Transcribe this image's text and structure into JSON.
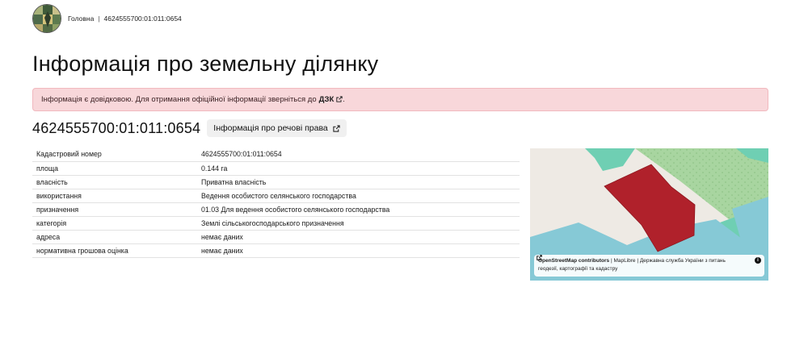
{
  "breadcrumb": {
    "home": "Головна",
    "separator": "|",
    "current": "4624555700:01:011:0654"
  },
  "page": {
    "title": "Інформація про земельну ділянку"
  },
  "alert": {
    "text": "Інформація є довідковою. Для отримання офіційної інформації зверніться до",
    "link": "ДЗК",
    "end": "."
  },
  "parcel": {
    "number": "4624555700:01:011:0654",
    "rights_button": "Інформація про речові права"
  },
  "rows": [
    {
      "key": "Кадастровий номер",
      "value": "4624555700:01:011:0654"
    },
    {
      "key": "площа",
      "value": "0.144 га"
    },
    {
      "key": "власність",
      "value": "Приватна власність"
    },
    {
      "key": "використання",
      "value": "Ведення особистого селянського господарства"
    },
    {
      "key": "призначення",
      "value": "01.03 Для ведення особистого селянського господарства"
    },
    {
      "key": "категорія",
      "value": "Землі сільськогосподарського призначення"
    },
    {
      "key": "адреса",
      "value": "немає даних"
    },
    {
      "key": "нормативна грошова оцінка",
      "value": "немає даних"
    }
  ],
  "map": {
    "attribution": {
      "osm": "OpenStreetMap contributors",
      "sep1": "|",
      "maplibre": "MapLibre",
      "sep2": "|",
      "agency_line1": "Державна служба України з питань",
      "agency_line2": "геодезії, картографії та кадастру"
    },
    "info_icon": "i",
    "colors": {
      "parcel": "#b0212b",
      "water": "#86c9d6",
      "grass": "#a8d5a0",
      "teal": "#6fcfb3",
      "base": "#eeeae4"
    }
  },
  "icons": {
    "external_link": "external-link-icon",
    "logo": "coat-of-arms-logo"
  }
}
